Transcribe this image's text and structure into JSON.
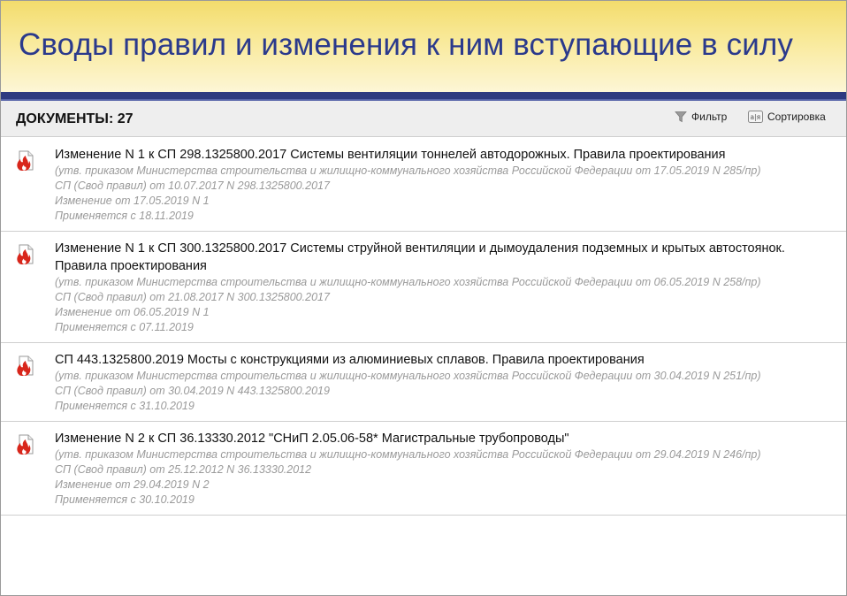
{
  "header": {
    "title": "Своды правил и изменения к ним вступающие в силу"
  },
  "toolbar": {
    "count_label": "ДОКУМЕНТЫ: 27",
    "filter_label": "Фильтр",
    "sort_label": "Сортировка"
  },
  "documents": [
    {
      "title": "Изменение N 1 к СП 298.1325800.2017 Системы вентиляции тоннелей автодорожных. Правила проектирования",
      "approved": "(утв. приказом Министерства строительства и жилищно-коммунального хозяйства Российской Федерации от 17.05.2019 N 285/пр)",
      "code": "СП (Свод правил) от 10.07.2017 N 298.1325800.2017",
      "change": "Изменение от 17.05.2019 N 1",
      "applies": "Применяется с 18.11.2019"
    },
    {
      "title": "Изменение N 1 к СП 300.1325800.2017 Системы струйной вентиляции и дымоудаления подземных и крытых автостоянок. Правила проектирования",
      "approved": "(утв. приказом Министерства строительства и жилищно-коммунального хозяйства Российской Федерации от 06.05.2019 N 258/пр)",
      "code": "СП (Свод правил) от 21.08.2017 N 300.1325800.2017",
      "change": "Изменение от 06.05.2019 N 1",
      "applies": "Применяется с 07.11.2019"
    },
    {
      "title": "СП 443.1325800.2019 Мосты с конструкциями из алюминиевых сплавов. Правила проектирования",
      "approved": "(утв. приказом Министерства строительства и жилищно-коммунального хозяйства Российской Федерации от 30.04.2019 N 251/пр)",
      "code": "СП (Свод правил) от 30.04.2019 N 443.1325800.2019",
      "applies": "Применяется с 31.10.2019"
    },
    {
      "title": "Изменение N 2 к СП 36.13330.2012 \"СНиП 2.05.06-58* Магистральные трубопроводы\"",
      "approved": "(утв. приказом Министерства строительства и жилищно-коммунального хозяйства Российской Федерации от 29.04.2019 N 246/пр)",
      "code": "СП (Свод правил) от 25.12.2012 N 36.13330.2012",
      "change": "Изменение от 29.04.2019 N 2",
      "applies": "Применяется с 30.10.2019"
    }
  ],
  "colors": {
    "title_blue": "#2b3a8c",
    "header_band": "#2e3a80",
    "flame_red": "#d8261b"
  }
}
